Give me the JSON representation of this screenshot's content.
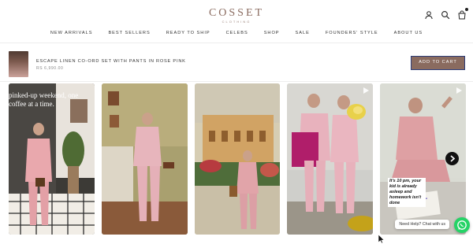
{
  "brand": {
    "name": "COSSET",
    "tagline": "CLOTHING",
    "color": "#8a6b5f"
  },
  "header": {
    "icons": [
      "account-icon",
      "search-icon",
      "cart-icon"
    ],
    "nav": [
      "NEW ARRIVALS",
      "BEST SELLERS",
      "READY TO SHIP",
      "CELEBS",
      "SHOP",
      "SALE",
      "FOUNDERS' STYLE",
      "ABOUT US"
    ]
  },
  "sticky_bar": {
    "product_title": "ESCAPE LINEN CO-ORD SET WITH PANTS IN ROSE PINK",
    "price": "RS 6,990.00",
    "add_to_cart": "ADD TO CART"
  },
  "videos": {
    "card1_caption": "pinked-up weekend, one coffee at a time.",
    "card5_caption": "It's 10 pm, your kid is already asleep and homework isn't done"
  },
  "chat": {
    "label": "Need Help? Chat with us",
    "icon": "whatsapp-icon",
    "accent": "#25d366"
  }
}
